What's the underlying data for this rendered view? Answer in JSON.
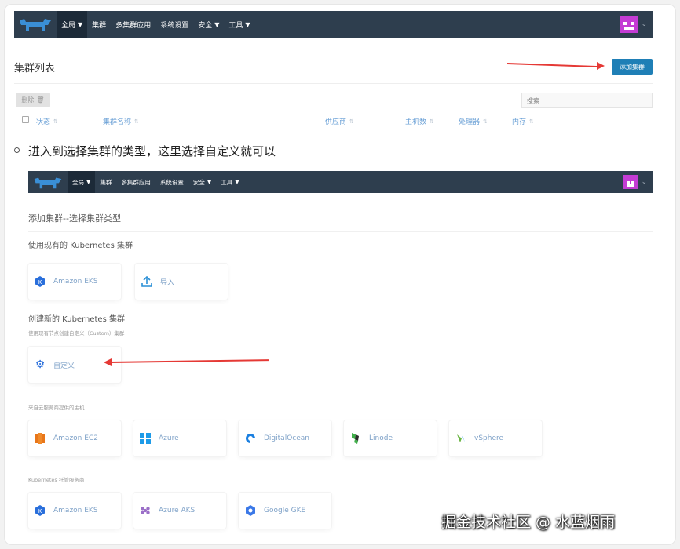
{
  "top_nav": {
    "items": [
      "全局",
      "集群",
      "多集群应用",
      "系统设置",
      "安全",
      "工具"
    ]
  },
  "cluster_list": {
    "title": "集群列表",
    "add_button": "添加集群",
    "delete_button": "删除",
    "search_placeholder": "搜索",
    "columns": [
      "状态",
      "集群名称",
      "供应商",
      "主机数",
      "处理器",
      "内存"
    ]
  },
  "instruction": "进入到选择集群的类型，这里选择自定义就可以",
  "inner_nav": {
    "items": [
      "全局",
      "集群",
      "多集群应用",
      "系统设置",
      "安全",
      "工具"
    ]
  },
  "add_cluster": {
    "title": "添加集群--选择集群类型",
    "existing_section": "使用现有的 Kubernetes 集群",
    "existing_tiles": [
      "Amazon EKS",
      "导入"
    ],
    "new_section": "创建新的 Kubernetes 集群",
    "new_section_hint": "使用现有节点创建自定义（Custom）集群",
    "custom_tile": "自定义",
    "cloud_hint": "来自云服务商提供的主机",
    "cloud_tiles": [
      "Amazon EC2",
      "Azure",
      "DigitalOcean",
      "Linode",
      "vSphere"
    ],
    "hosted_hint": "Kubernetes 托管服务商",
    "hosted_tiles": [
      "Amazon EKS",
      "Azure AKS",
      "Google GKE"
    ]
  },
  "watermark": "掘金技术社区 @ 水蓝烟雨",
  "colors": {
    "nav_bg": "#2e3e4e",
    "accent": "#1f7fb6",
    "arrow": "#e53935",
    "avatar": "#c43cd4"
  }
}
